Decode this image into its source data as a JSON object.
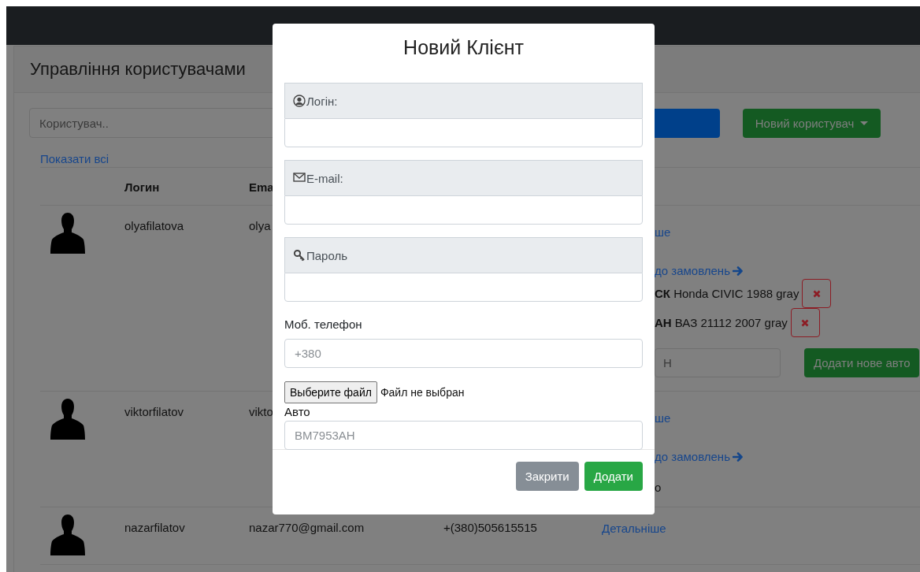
{
  "page": {
    "title": "Управління користувачами",
    "search": {
      "placeholder": "Користувач.."
    },
    "new_user_button": "Новий користувач",
    "show_all_link": "Показати всі",
    "table": {
      "columns": [
        "Логин",
        "Ema"
      ],
      "rows": [
        {
          "login": "olyafilatova",
          "email": "olya",
          "details_link": "ше",
          "orders_link": "до замовлень",
          "cars": [
            {
              "plate": "СК",
              "model": "Honda CIVIC 1988 gray"
            },
            {
              "plate": "АН",
              "model": "ВАЗ 21112 2007 gray"
            }
          ],
          "new_car": {
            "placeholder": "Н"
          },
          "add_car_button": "Додати нове авто"
        },
        {
          "login": "viktorfilatov",
          "email": "vikto",
          "details_link": "ше",
          "orders_link": "до замовлень",
          "column_5_text": "о"
        },
        {
          "login": "nazarfilatov",
          "email": "nazar770@gmail.com",
          "phone": "+(380)505615515",
          "details_link": "Детальніше"
        }
      ]
    }
  },
  "modal": {
    "title": "Новий Клієнт",
    "groups": [
      {
        "kind": "user",
        "label": "Логін:"
      },
      {
        "kind": "mail",
        "label": "E-mail:"
      },
      {
        "kind": "key",
        "label": "Пароль"
      }
    ],
    "phone": {
      "label": "Моб. телефон",
      "placeholder": "+380"
    },
    "file": {
      "button": "Выберите файл",
      "status": "Файл не выбран"
    },
    "car": {
      "label": "Авто",
      "placeholder": "BM7953AH"
    },
    "buttons": [
      {
        "kind": "secondary",
        "label": "Закрити"
      },
      {
        "kind": "primary",
        "label": "Додати"
      }
    ]
  }
}
